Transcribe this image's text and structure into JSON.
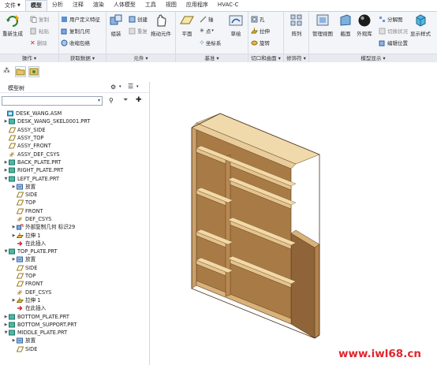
{
  "menu": {
    "tabs": [
      "文件",
      "模型",
      "分析",
      "注释",
      "渲染",
      "人体模型",
      "工具",
      "视图",
      "应用程序",
      "HVAC-C"
    ],
    "active": "模型"
  },
  "ribbon": {
    "groups": [
      {
        "label": "操作",
        "buttons": [
          "重新生成",
          "复制",
          "粘贴",
          "删除"
        ]
      },
      {
        "label": "获取数据",
        "buttons": [
          "用户定义特征",
          "复制几何",
          "收缩包络"
        ]
      },
      {
        "label": "元件",
        "buttons": [
          "组装",
          "创建",
          "重复",
          "拖动元件"
        ]
      },
      {
        "label": "基准",
        "buttons": [
          "平面",
          "轴",
          "点",
          "坐标系",
          "草绘"
        ]
      },
      {
        "label": "切口和曲面",
        "buttons": [
          "孔",
          "拉伸",
          "旋转"
        ]
      },
      {
        "label": "修饰符",
        "buttons": [
          "阵列"
        ]
      },
      {
        "label": "模型显示",
        "buttons": [
          "管理视图",
          "截面",
          "外观库",
          "分解图",
          "切换状况",
          "编辑位置",
          "显示样式"
        ]
      }
    ]
  },
  "model_tree": {
    "title": "模型树",
    "search_value": "",
    "items": [
      {
        "label": "DESK_WANG.ASM",
        "icon": "assembly-icon",
        "level": 0,
        "expander": ""
      },
      {
        "label": "DESK_WANG_SKEL0001.PRT",
        "icon": "part-icon",
        "level": 1,
        "expander": "▶"
      },
      {
        "label": "ASSY_SIDE",
        "icon": "datum-plane-icon",
        "level": 1,
        "expander": ""
      },
      {
        "label": "ASSY_TOP",
        "icon": "datum-plane-icon",
        "level": 1,
        "expander": ""
      },
      {
        "label": "ASSY_FRONT",
        "icon": "datum-plane-icon",
        "level": 1,
        "expander": ""
      },
      {
        "label": "ASSY_DEF_CSYS",
        "icon": "csys-icon",
        "level": 1,
        "expander": ""
      },
      {
        "label": "BACK_PLATE.PRT",
        "icon": "part-icon",
        "level": 1,
        "expander": "▶"
      },
      {
        "label": "RIGHT_PLATE.PRT",
        "icon": "part-icon",
        "level": 1,
        "expander": "▶"
      },
      {
        "label": "LEFT_PLATE.PRT",
        "icon": "part-icon",
        "level": 1,
        "expander": "▼"
      },
      {
        "label": "放置",
        "icon": "placement-icon",
        "level": 2,
        "expander": "▶"
      },
      {
        "label": "SIDE",
        "icon": "datum-plane-icon",
        "level": 2,
        "expander": ""
      },
      {
        "label": "TOP",
        "icon": "datum-plane-icon",
        "level": 2,
        "expander": ""
      },
      {
        "label": "FRONT",
        "icon": "datum-plane-icon",
        "level": 2,
        "expander": ""
      },
      {
        "label": "DEF_CSYS",
        "icon": "csys-icon",
        "level": 2,
        "expander": ""
      },
      {
        "label": "外部复制几何 标识29",
        "icon": "copy-geom-icon",
        "level": 2,
        "expander": "▶"
      },
      {
        "label": "拉伸 1",
        "icon": "extrude-icon",
        "level": 2,
        "expander": "▶"
      },
      {
        "label": "在此插入",
        "icon": "insert-arrow-icon",
        "level": 2,
        "expander": ""
      },
      {
        "label": "TOP_PLATE.PRT",
        "icon": "part-icon",
        "level": 1,
        "expander": "▼"
      },
      {
        "label": "放置",
        "icon": "placement-icon",
        "level": 2,
        "expander": "▶"
      },
      {
        "label": "SIDE",
        "icon": "datum-plane-icon",
        "level": 2,
        "expander": ""
      },
      {
        "label": "TOP",
        "icon": "datum-plane-icon",
        "level": 2,
        "expander": ""
      },
      {
        "label": "FRONT",
        "icon": "datum-plane-icon",
        "level": 2,
        "expander": ""
      },
      {
        "label": "DEF_CSYS",
        "icon": "csys-icon",
        "level": 2,
        "expander": ""
      },
      {
        "label": "拉伸 1",
        "icon": "extrude-icon",
        "level": 2,
        "expander": "▶"
      },
      {
        "label": "在此插入",
        "icon": "insert-arrow-icon",
        "level": 2,
        "expander": ""
      },
      {
        "label": "BOTTOM_PLATE.PRT",
        "icon": "part-icon",
        "level": 1,
        "expander": "▶"
      },
      {
        "label": "BOTTOM_SUPPORT.PRT",
        "icon": "part-icon",
        "level": 1,
        "expander": "▶"
      },
      {
        "label": "MIDDLE_PLATE.PRT",
        "icon": "part-icon",
        "level": 1,
        "expander": "▼"
      },
      {
        "label": "放置",
        "icon": "placement-icon",
        "level": 2,
        "expander": "▶"
      },
      {
        "label": "SIDE",
        "icon": "datum-plane-icon",
        "level": 2,
        "expander": ""
      }
    ]
  },
  "watermark": "www.iwl68.cn",
  "colors": {
    "wood_front": "#c99d64",
    "wood_top": "#e8cc9a",
    "wood_side": "#8e6438",
    "wood_edge": "#5a3c1e",
    "ribbon_bg": "#f3f5f8",
    "watermark": "#e2252b"
  }
}
